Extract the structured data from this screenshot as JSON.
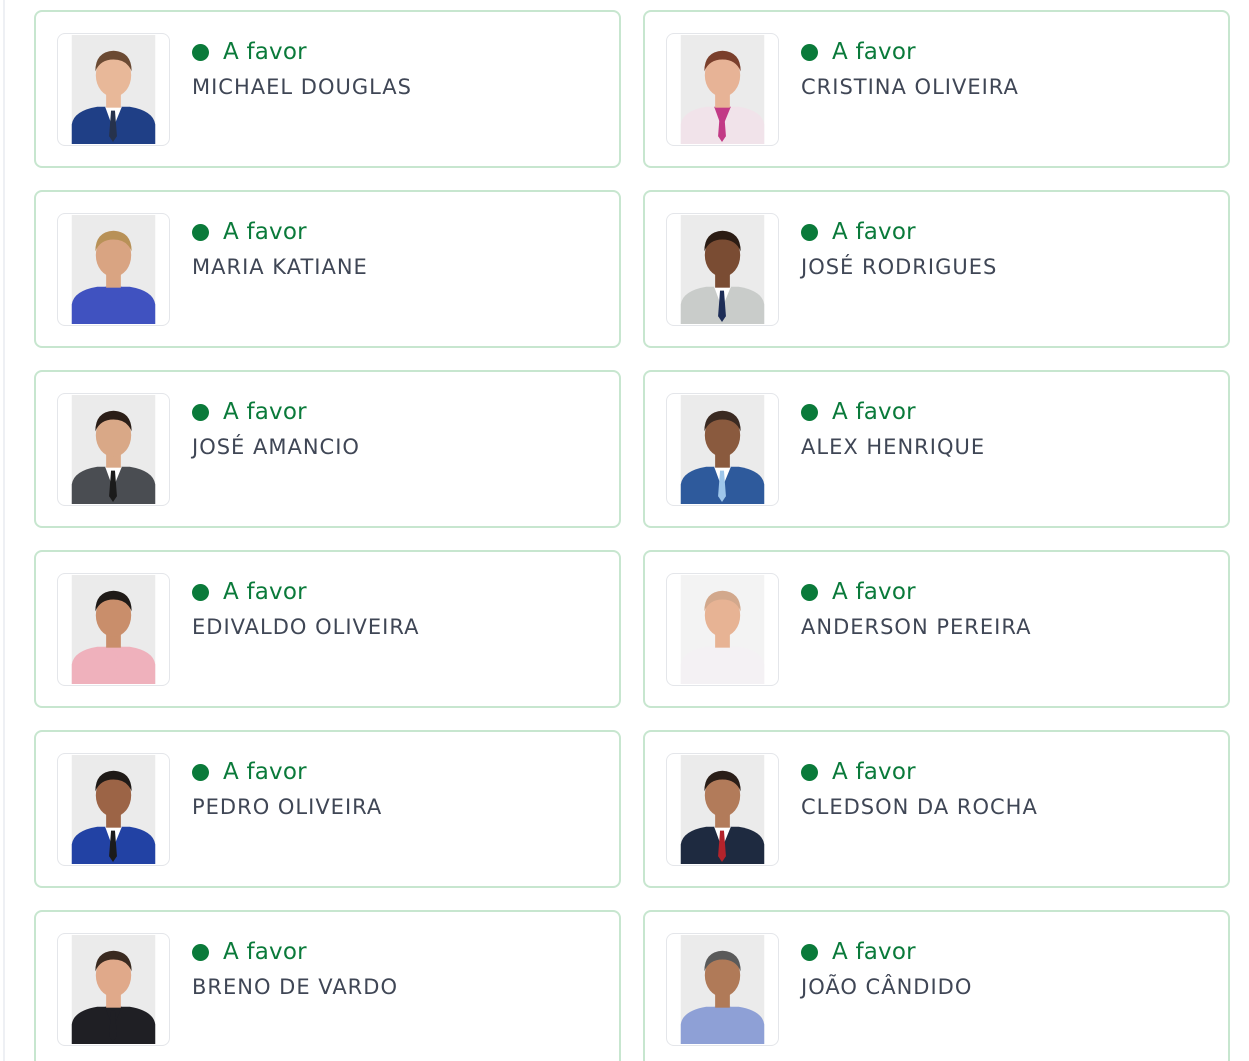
{
  "vote_status": {
    "label": "A favor",
    "color": "#0a7a3a"
  },
  "councillors": [
    {
      "name": "MICHAEL DOUGLAS",
      "photo_bg": "#ebebeb",
      "skin": "#e8b899",
      "hair": "#6b4a33",
      "suit": "#1f3f86",
      "shirt": "#ffffff",
      "tie": "#26324c"
    },
    {
      "name": "CRISTINA OLIVEIRA",
      "photo_bg": "#ebebeb",
      "skin": "#e7b396",
      "hair": "#7a3f2c",
      "suit": "#f1e3ea",
      "shirt": "#c23a86",
      "tie": "#c23a86"
    },
    {
      "name": "MARIA KATIANE",
      "photo_bg": "#ebebeb",
      "skin": "#d9a482",
      "hair": "#b89157",
      "suit": "#4052c0",
      "shirt": "#4052c0",
      "tie": "#4052c0"
    },
    {
      "name": "JOSÉ RODRIGUES",
      "photo_bg": "#ebebeb",
      "skin": "#7a4c33",
      "hair": "#2b1c14",
      "suit": "#c9ccca",
      "shirt": "#ffffff",
      "tie": "#1d2d57"
    },
    {
      "name": "JOSÉ AMANCIO",
      "photo_bg": "#ebebeb",
      "skin": "#d9a887",
      "hair": "#2b1e17",
      "suit": "#4a4d52",
      "shirt": "#ffffff",
      "tie": "#1b1b1b"
    },
    {
      "name": "ALEX HENRIQUE",
      "photo_bg": "#ebebeb",
      "skin": "#8a5a3e",
      "hair": "#3a2a22",
      "suit": "#2e5a9c",
      "shirt": "#ffffff",
      "tie": "#9ec6ea"
    },
    {
      "name": "EDIVALDO OLIVEIRA",
      "photo_bg": "#ebebeb",
      "skin": "#c98e6b",
      "hair": "#1f1a17",
      "suit": "#efb1bc",
      "shirt": "#efb1bc",
      "tie": "#efb1bc"
    },
    {
      "name": "ANDERSON PEREIRA",
      "photo_bg": "#f3f3f3",
      "skin": "#e7b394",
      "hair": "#d2a88c",
      "suit": "#f4f1f4",
      "shirt": "#f4f1f4",
      "tie": "#f4f1f4"
    },
    {
      "name": "PEDRO OLIVEIRA",
      "photo_bg": "#ebebeb",
      "skin": "#9c6446",
      "hair": "#1f1a17",
      "suit": "#2242a4",
      "shirt": "#ffffff",
      "tie": "#1b1b1b"
    },
    {
      "name": "CLEDSON DA ROCHA",
      "photo_bg": "#ebebeb",
      "skin": "#b27b5a",
      "hair": "#2a1e18",
      "suit": "#1e2a40",
      "shirt": "#ffffff",
      "tie": "#b3232b"
    },
    {
      "name": "BRENO DE VARDO",
      "photo_bg": "#ebebeb",
      "skin": "#e0a98a",
      "hair": "#3a2a20",
      "suit": "#1f1f24",
      "shirt": "#1f1f24",
      "tie": "#1f1f24"
    },
    {
      "name": "JOÃO CÂNDIDO",
      "photo_bg": "#ebebeb",
      "skin": "#b07a58",
      "hair": "#5a5a5a",
      "suit": "#8ea0d6",
      "shirt": "#8ea0d6",
      "tie": "#8ea0d6"
    }
  ]
}
